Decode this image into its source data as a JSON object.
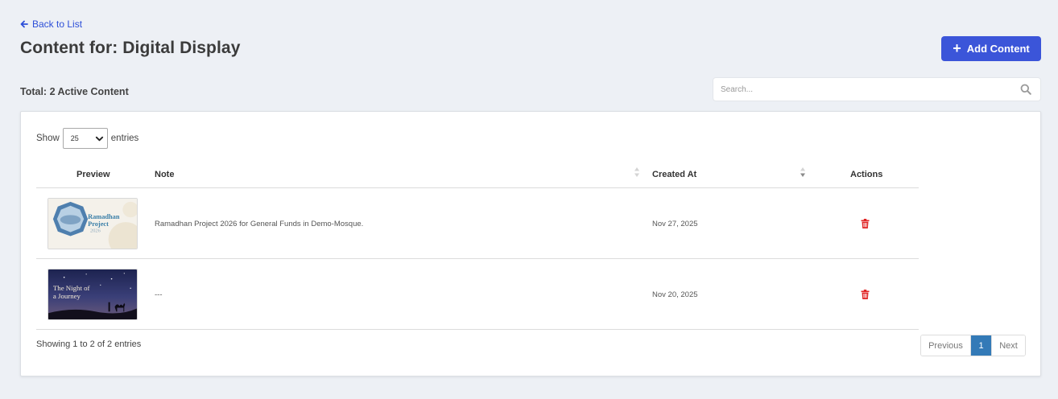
{
  "header": {
    "back_label": "Back to List",
    "title": "Content for: Digital Display",
    "add_button_label": "Add Content",
    "total_label": "Total: 2 Active Content"
  },
  "search": {
    "placeholder": "Search..."
  },
  "table_controls": {
    "show_label": "Show",
    "entries_label": "entries",
    "page_size": "25"
  },
  "columns": {
    "preview": "Preview",
    "note": "Note",
    "created_at": "Created At",
    "actions": "Actions"
  },
  "rows": [
    {
      "thumbnail": {
        "title_line1": "Ramadhan",
        "title_line2": "Project",
        "year": "2026"
      },
      "note": "Ramadhan Project 2026 for General Funds in Demo-Mosque.",
      "created_at": "Nov 27, 2025",
      "action_icon": "trash-icon"
    },
    {
      "thumbnail": {
        "title_line1": "The Night of",
        "title_line2": "a Journey"
      },
      "note": "---",
      "created_at": "Nov 20, 2025",
      "action_icon": "trash-icon"
    }
  ],
  "footer": {
    "showing": "Showing 1 to 2 of 2 entries",
    "previous": "Previous",
    "current_page": "1",
    "next": "Next"
  },
  "colors": {
    "accent": "#3b55d9",
    "link": "#2d4fd8",
    "delete": "#e02424",
    "page_active": "#337ab7"
  }
}
